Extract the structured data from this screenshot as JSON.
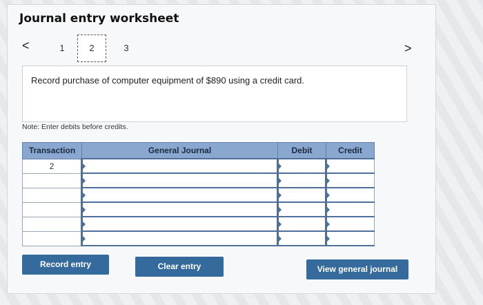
{
  "worksheet": {
    "title": "Journal entry worksheet",
    "nav_prev": "<",
    "nav_next": ">",
    "steps": [
      "1",
      "2",
      "3"
    ],
    "active_step": "2",
    "prompt": "Record purchase of computer equipment of $890 using a credit card.",
    "note": "Note: Enter debits before credits."
  },
  "table": {
    "headers": {
      "transaction": "Transaction",
      "general_journal": "General Journal",
      "debit": "Debit",
      "credit": "Credit"
    },
    "rows": [
      {
        "transaction": "2",
        "general_journal": "",
        "debit": "",
        "credit": ""
      },
      {
        "transaction": "",
        "general_journal": "",
        "debit": "",
        "credit": ""
      },
      {
        "transaction": "",
        "general_journal": "",
        "debit": "",
        "credit": ""
      },
      {
        "transaction": "",
        "general_journal": "",
        "debit": "",
        "credit": ""
      },
      {
        "transaction": "",
        "general_journal": "",
        "debit": "",
        "credit": ""
      },
      {
        "transaction": "",
        "general_journal": "",
        "debit": "",
        "credit": ""
      }
    ]
  },
  "buttons": {
    "record": "Record entry",
    "clear": "Clear entry",
    "view": "View general journal"
  },
  "colors": {
    "header_bg": "#8aa8cf",
    "button_bg": "#356a9c"
  }
}
